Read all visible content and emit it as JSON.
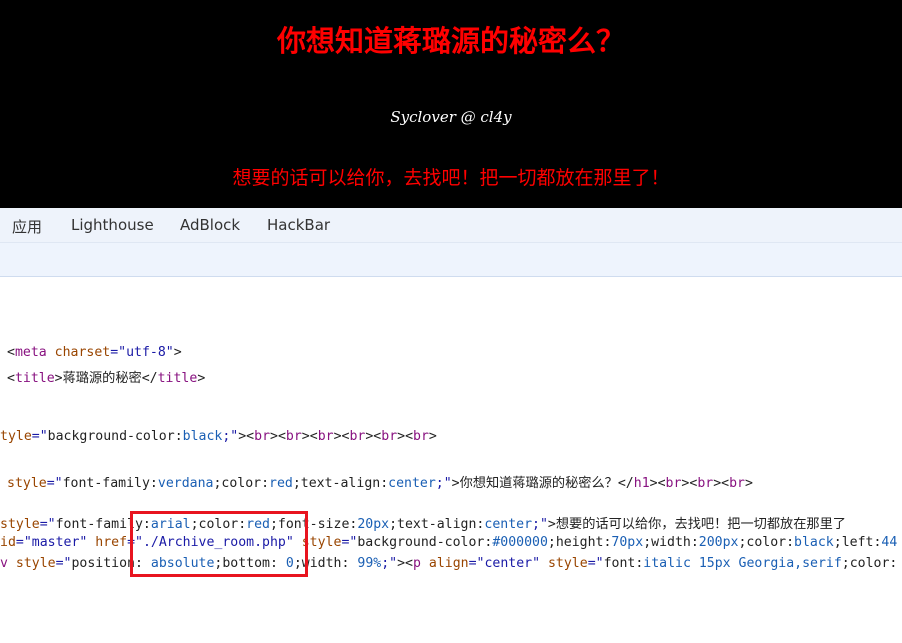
{
  "page": {
    "heading": "你想知道蒋璐源的秘密么？",
    "signature": "Syclover @ cl4y",
    "message": "想要的话可以给你，去找吧！把一切都放在那里了！"
  },
  "bookmarks": [
    "应用",
    "Lighthouse",
    "AdBlock",
    "HackBar"
  ],
  "source_lines": [
    [
      [
        "<",
        "text"
      ],
      [
        "meta ",
        "tag"
      ],
      [
        "charset",
        "attr"
      ],
      [
        "=\"utf-8\"",
        "val"
      ],
      [
        ">",
        "text"
      ]
    ],
    [
      [
        "<",
        "text"
      ],
      [
        "title",
        "tag"
      ],
      [
        ">蒋璐源的秘密</",
        "text"
      ],
      [
        "title",
        "tag"
      ],
      [
        ">",
        "text"
      ]
    ],
    [
      [
        "tyle",
        "attr"
      ],
      [
        "=\"",
        "val"
      ],
      [
        "background-color:",
        "text"
      ],
      [
        "black",
        "kw"
      ],
      [
        ";\"",
        "val"
      ],
      [
        "><",
        "text"
      ],
      [
        "br",
        "tag"
      ],
      [
        "><",
        "text"
      ],
      [
        "br",
        "tag"
      ],
      [
        "><",
        "text"
      ],
      [
        "br",
        "tag"
      ],
      [
        "><",
        "text"
      ],
      [
        "br",
        "tag"
      ],
      [
        "><",
        "text"
      ],
      [
        "br",
        "tag"
      ],
      [
        "><",
        "text"
      ],
      [
        "br",
        "tag"
      ],
      [
        ">",
        "text"
      ]
    ],
    [
      [
        "style",
        "attr"
      ],
      [
        "=\"",
        "val"
      ],
      [
        "font-family:",
        "text"
      ],
      [
        "verdana",
        "kw"
      ],
      [
        ";color:",
        "text"
      ],
      [
        "red",
        "kw"
      ],
      [
        ";text-align:",
        "text"
      ],
      [
        "center",
        "kw"
      ],
      [
        ";\"",
        "val"
      ],
      [
        ">你想知道蒋璐源的秘密么？</",
        "text"
      ],
      [
        "h1",
        "tag"
      ],
      [
        "><",
        "text"
      ],
      [
        "br",
        "tag"
      ],
      [
        "><",
        "text"
      ],
      [
        "br",
        "tag"
      ],
      [
        "><",
        "text"
      ],
      [
        "br",
        "tag"
      ],
      [
        ">",
        "text"
      ]
    ],
    [
      [
        "style",
        "attr"
      ],
      [
        "=\"",
        "val"
      ],
      [
        "font-family:",
        "text"
      ],
      [
        "arial",
        "kw"
      ],
      [
        ";color:",
        "text"
      ],
      [
        "red",
        "kw"
      ],
      [
        ";font-size:",
        "text"
      ],
      [
        "20px",
        "kw"
      ],
      [
        ";text-align:",
        "text"
      ],
      [
        "center",
        "kw"
      ],
      [
        ";\"",
        "val"
      ],
      [
        ">想要的话可以给你，去找吧！把一切都放在那里了",
        "text"
      ]
    ],
    [
      [
        "id",
        "attr"
      ],
      [
        "=\"master\" ",
        "val"
      ],
      [
        "href",
        "attr"
      ],
      [
        "=\"./Archive_room.php\" ",
        "val"
      ],
      [
        "style",
        "attr"
      ],
      [
        "=\"",
        "val"
      ],
      [
        "background-color:",
        "text"
      ],
      [
        "#000000",
        "kw"
      ],
      [
        ";height:",
        "text"
      ],
      [
        "70px",
        "kw"
      ],
      [
        ";width:",
        "text"
      ],
      [
        "200px",
        "kw"
      ],
      [
        ";color:",
        "text"
      ],
      [
        "black",
        "kw"
      ],
      [
        ";left:",
        "text"
      ],
      [
        "44",
        "kw"
      ]
    ],
    [
      [
        "v ",
        "tag"
      ],
      [
        "style",
        "attr"
      ],
      [
        "=\"",
        "val"
      ],
      [
        "position: ",
        "text"
      ],
      [
        "absolute",
        "kw"
      ],
      [
        ";bottom: ",
        "text"
      ],
      [
        "0",
        "kw"
      ],
      [
        ";width: ",
        "text"
      ],
      [
        "99%",
        "kw"
      ],
      [
        ";\"",
        "val"
      ],
      [
        "><",
        "text"
      ],
      [
        "p ",
        "tag"
      ],
      [
        "align",
        "attr"
      ],
      [
        "=\"center\" ",
        "val"
      ],
      [
        "style",
        "attr"
      ],
      [
        "=\"",
        "val"
      ],
      [
        "font:",
        "text"
      ],
      [
        "italic 15px Georgia,serif",
        "kw"
      ],
      [
        ";color:",
        "text"
      ]
    ]
  ],
  "highlight_color": "#e8141f"
}
